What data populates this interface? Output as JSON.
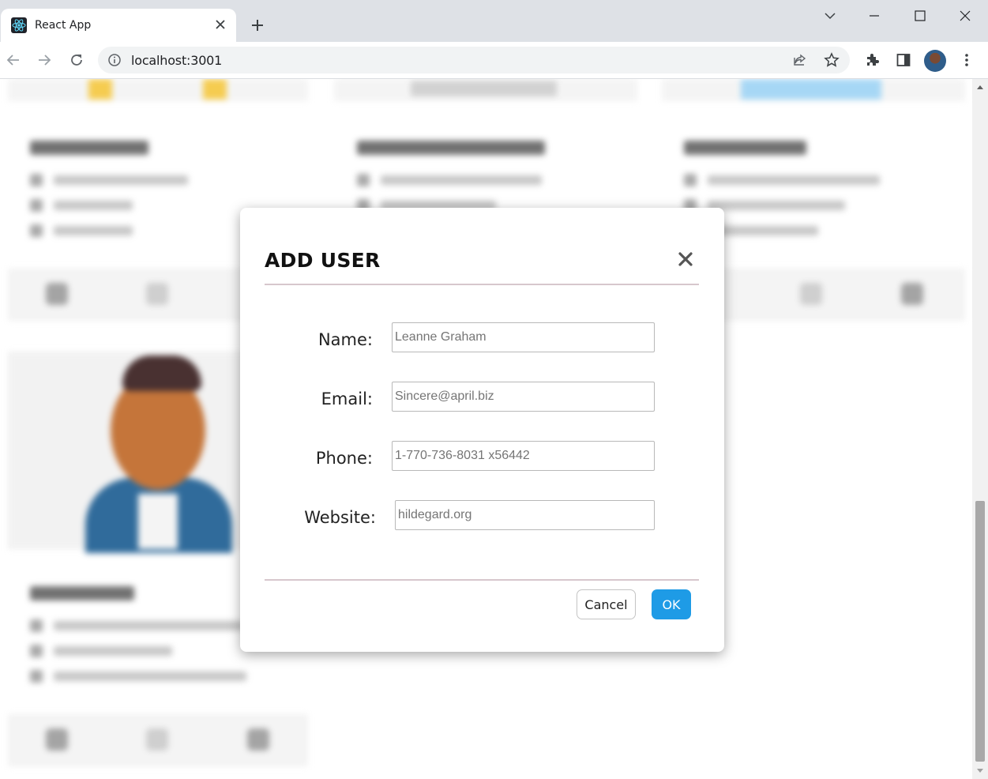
{
  "browser": {
    "tab_title": "React App",
    "url": "localhost:3001",
    "icons": {
      "favicon": "react-logo-icon",
      "tab_close": "close-icon",
      "new_tab": "plus-icon",
      "tab_search": "chevron-down-icon",
      "minimize": "minimize-icon",
      "maximize": "maximize-icon",
      "window_close": "close-icon",
      "back": "arrow-left-icon",
      "forward": "arrow-right-icon",
      "reload": "reload-icon",
      "site_info": "info-icon",
      "share": "share-icon",
      "bookmark": "star-icon",
      "extensions": "puzzle-icon",
      "side_panel": "side-panel-icon",
      "menu": "kebab-menu-icon"
    }
  },
  "modal": {
    "title": "ADD USER",
    "fields": [
      {
        "label": "Name:",
        "placeholder": "Leanne Graham"
      },
      {
        "label": "Email:",
        "placeholder": "Sincere@april.biz"
      },
      {
        "label": "Phone:",
        "placeholder": "1-770-736-8031 x56442"
      },
      {
        "label": "Website:",
        "placeholder": "hildegard.org"
      }
    ],
    "cancel_label": "Cancel",
    "ok_label": "OK"
  },
  "colors": {
    "primary_button": "#1e9be6",
    "divider": "#d7c7cd",
    "chrome_bg": "#dee1e6"
  }
}
